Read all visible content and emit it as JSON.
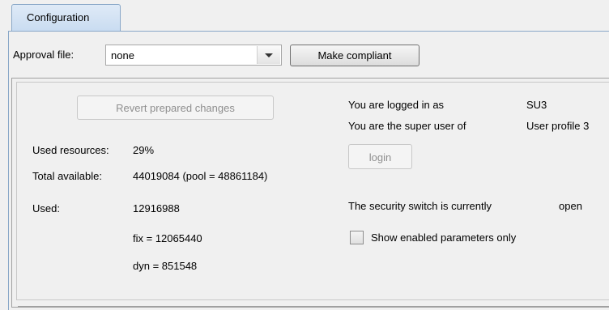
{
  "tabs": [
    {
      "label": "Configuration",
      "active": true
    }
  ],
  "toolbar": {
    "approval_label": "Approval file:",
    "approval_value": "none",
    "make_compliant_label": "Make compliant"
  },
  "panel": {
    "revert_label": "Revert prepared changes",
    "used_resources_label": "Used resources:",
    "used_resources_value": "29%",
    "total_available_label": "Total available:",
    "total_available_value": "44019084 (pool = 48861184)",
    "used_label": "Used:",
    "used_value": "12916988",
    "fix_value": "fix = 12065440",
    "dyn_value": "dyn = 851548",
    "logged_in_label": "You are logged in as",
    "logged_in_user": "SU3",
    "super_user_label": "You are the super user of",
    "super_user_value": "User profile 3",
    "login_label": "login",
    "security_label": "The security switch is currently",
    "security_value": "open",
    "show_enabled_label": "Show enabled parameters only",
    "show_enabled_checked": false
  }
}
